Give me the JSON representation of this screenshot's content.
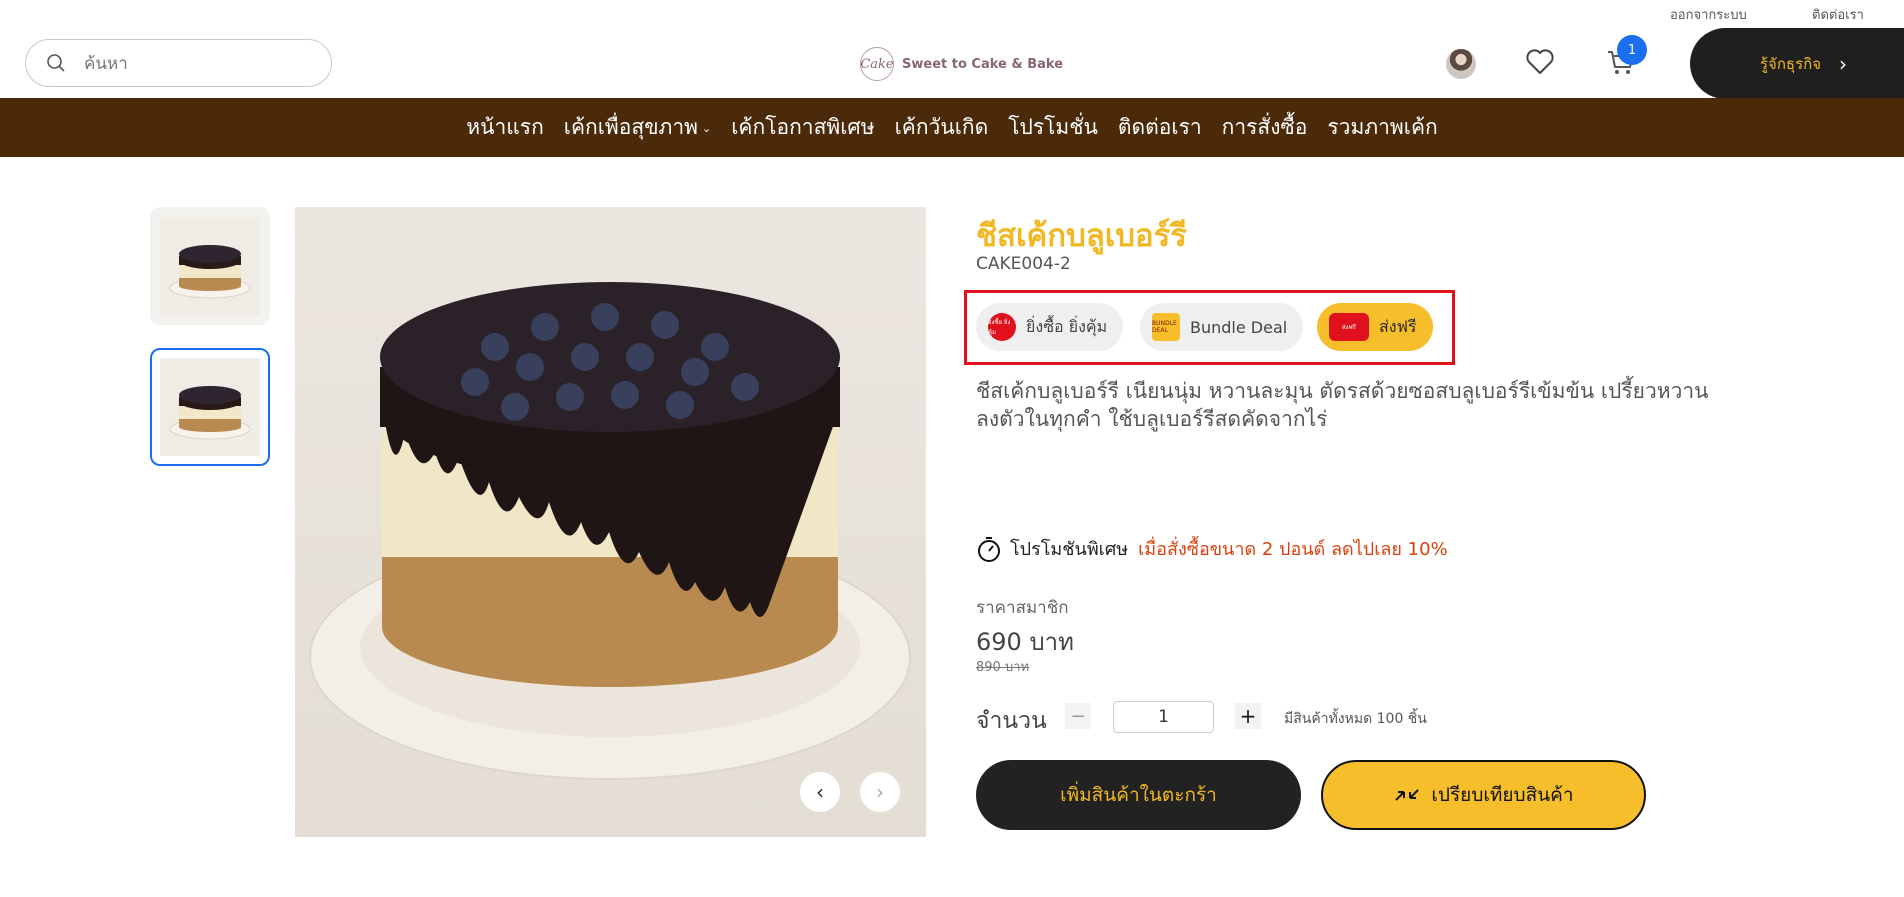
{
  "top_links": {
    "logout": "ออกจากระบบ",
    "contact": "ติดต่อเรา"
  },
  "search": {
    "placeholder": "ค้นหา"
  },
  "logo": {
    "mark": "Cake",
    "name": "Sweet to Cake & Bake",
    "tagline": ""
  },
  "header": {
    "cart_count": "1",
    "business_button": "รู้จักธุรกิจ",
    "business_chevron": "›"
  },
  "nav": {
    "items": [
      "หน้าแรก",
      "เค้กเพื่อสุขภาพ",
      "เค้กโอกาสพิเศษ",
      "เค้กวันเกิด",
      "โปรโมชั่น",
      "ติดต่อเรา",
      "การสั่งซื้อ",
      "รวมภาพเค้ก"
    ],
    "dropdown_glyph": "⌄"
  },
  "product": {
    "title": "ชีสเค้กบลูเบอร์รี",
    "sku": "CAKE004-2",
    "badges": [
      {
        "label": "ยิ่งซื้อ ยิ่งคุ้ม",
        "icon": "hot-deal-icon",
        "icon_text": "ยิ่งซื้อ ยิ่งคุ้ม",
        "color": "#e0101d"
      },
      {
        "label": "Bundle Deal",
        "icon": "gift-box-icon",
        "icon_text": "BUNDLE DEAL",
        "color": "#f7be2c"
      },
      {
        "label": "ส่งฟรี",
        "icon": "delivery-truck-icon",
        "icon_text": "ส่งฟรี",
        "color": "#e0101d"
      }
    ],
    "description": "ชีสเค้กบลูเบอร์รี เนียนนุ่ม หวานละมุน ตัดรสด้วยซอสบลูเบอร์รีเข้มข้น เปรี้ยวหวานลงตัวในทุกคำ ใช้บลูเบอร์รีสดคัดจากไร่",
    "promo_label": "โปรโมชันพิเศษ",
    "promo_value": "เมื่อสั่งซื้อขนาด 2 ปอนด์ ลดไปเลย 10%",
    "member_label": "ราคาสมาชิก",
    "price": "690 บาท",
    "old_price": "890 บาท",
    "quantity_label": "จำนวน",
    "quantity": "1",
    "qty_minus": "−",
    "qty_plus": "+",
    "stock_text": "มีสินค้าทั้งหมด 100 ชิ้น",
    "add_to_cart": "เพิ่มสินค้าในตะกร้า",
    "compare": "เปรียบเทียบสินค้า"
  },
  "gallery": {
    "prev": "‹",
    "next": "›"
  },
  "colors": {
    "accent": "#f2b824",
    "nav_bg": "#4a2a08",
    "dark": "#222222",
    "highlight_frame": "#e0101d",
    "badge_blue": "#1a6ff0"
  }
}
